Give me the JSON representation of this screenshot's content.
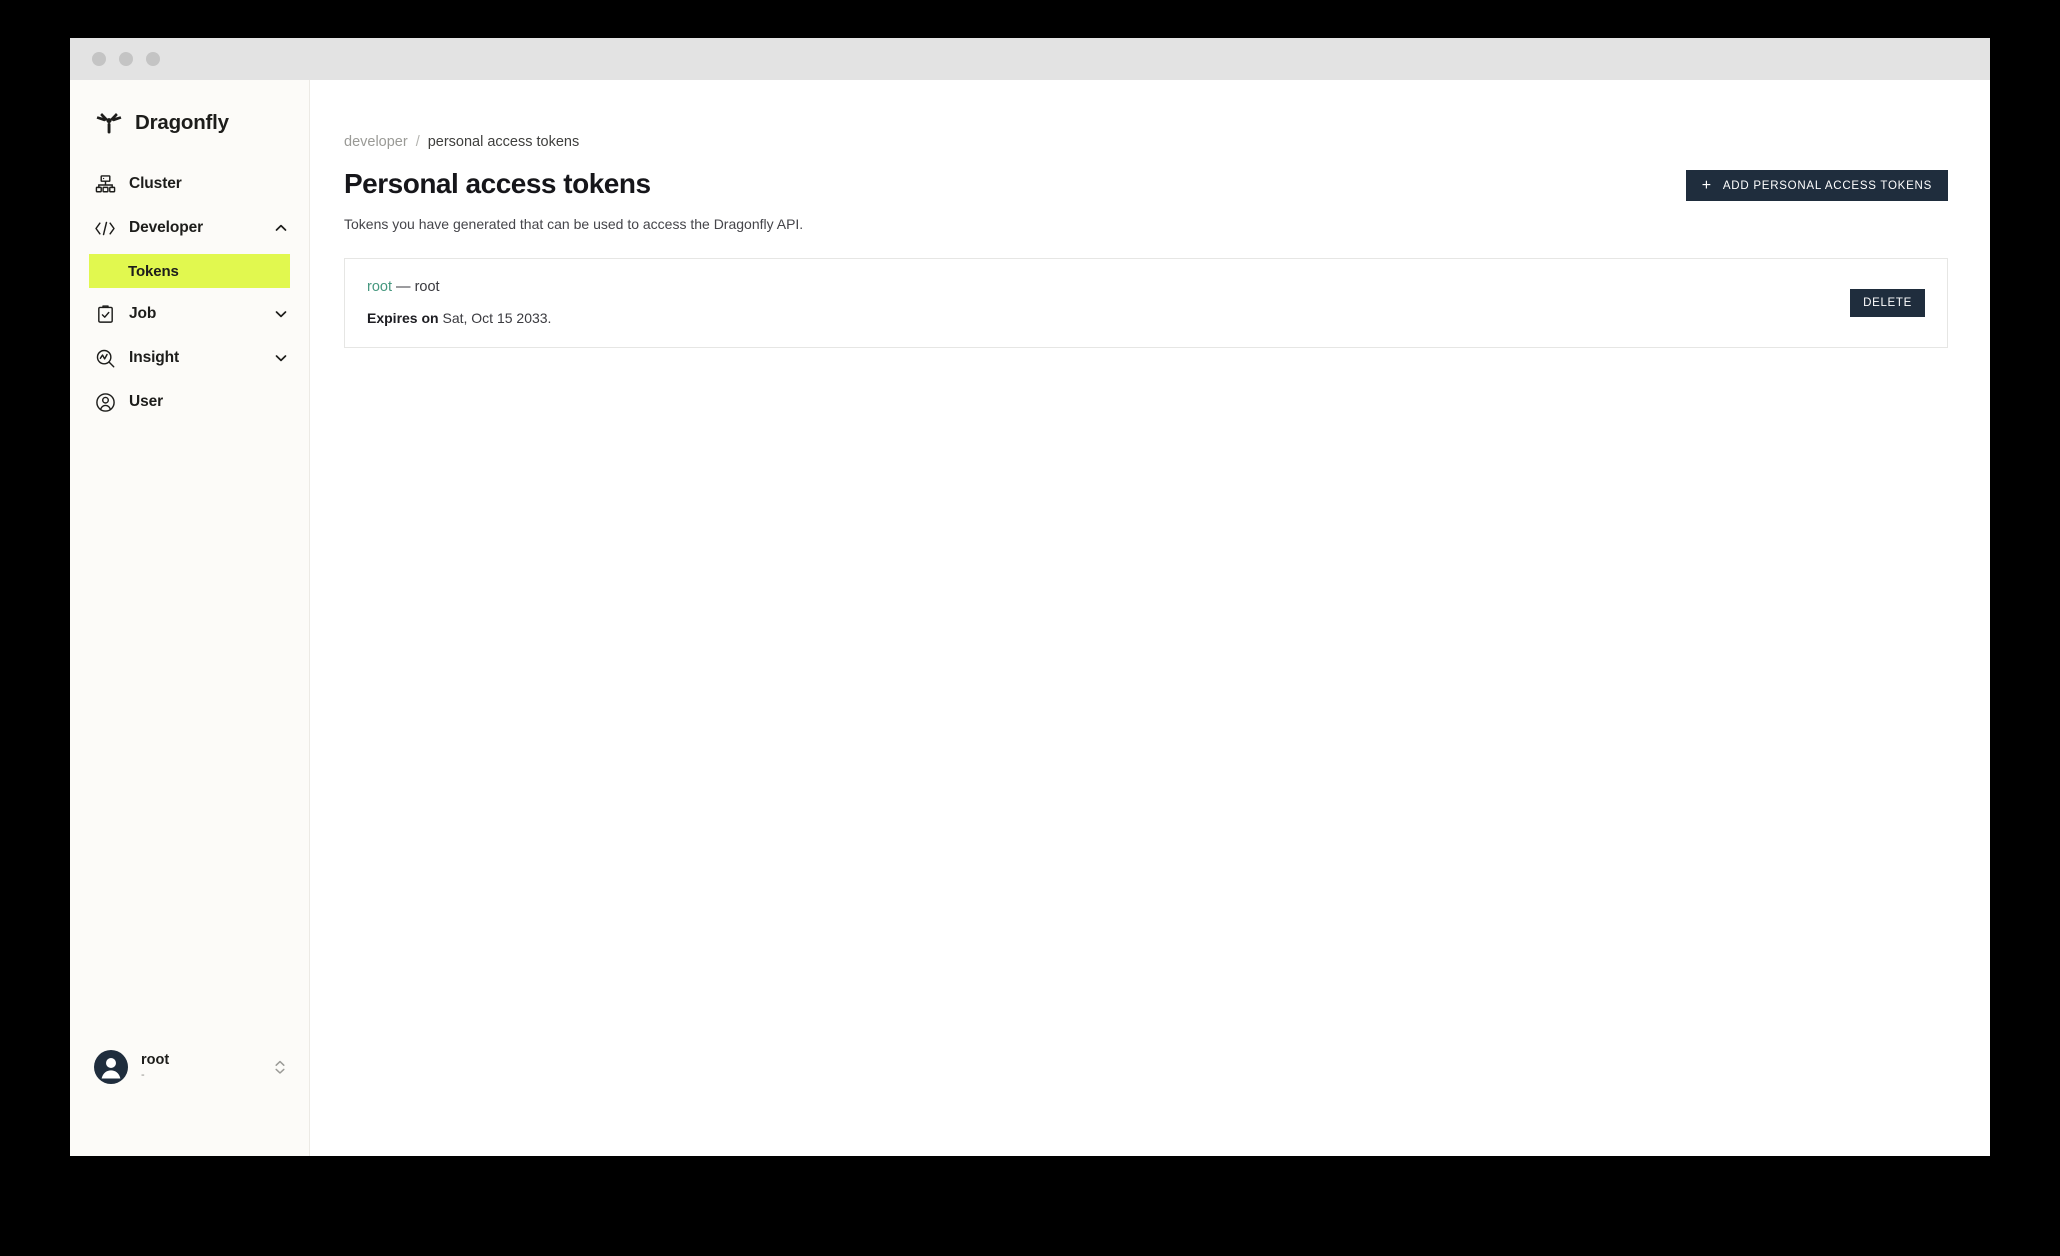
{
  "window": {
    "traffic_lights": [
      "close",
      "minimize",
      "maximize"
    ]
  },
  "sidebar": {
    "brand": {
      "name": "Dragonfly",
      "logo_icon": "dragonfly-logo-icon"
    },
    "items": [
      {
        "label": "Cluster",
        "icon": "cluster-icon",
        "expandable": false,
        "expanded": false
      },
      {
        "label": "Developer",
        "icon": "code-brackets-icon",
        "expandable": true,
        "expanded": true
      },
      {
        "label": "Job",
        "icon": "clipboard-check-icon",
        "expandable": true,
        "expanded": false
      },
      {
        "label": "Insight",
        "icon": "insight-magnifier-icon",
        "expandable": true,
        "expanded": false
      },
      {
        "label": "User",
        "icon": "user-circle-icon",
        "expandable": false,
        "expanded": false
      }
    ],
    "developer_children": [
      {
        "label": "Tokens",
        "active": true
      }
    ],
    "user": {
      "name": "root",
      "subtitle": "-",
      "avatar_icon": "avatar-person-icon",
      "selector_icon": "chevron-up-down-icon"
    }
  },
  "main": {
    "breadcrumb": {
      "parent": "developer",
      "separator": "/",
      "current": "personal access tokens"
    },
    "page_title": "Personal access tokens",
    "add_button": {
      "label": "ADD PERSONAL ACCESS TOKENS",
      "plus_icon": "plus-icon"
    },
    "subtitle": "Tokens you have generated that can be used to access the Dragonfly API.",
    "tokens": [
      {
        "name": "root",
        "separator": "—",
        "owner": "root",
        "expires_label": "Expires on",
        "expires_value": "Sat, Oct 15 2033.",
        "delete_label": "DELETE"
      }
    ]
  },
  "colors": {
    "accent_highlight": "#e1f84f",
    "button_dark": "#1f2d3d",
    "token_name": "#46987f",
    "sidebar_bg": "#fcfbf8",
    "titlebar_bg": "#e3e3e3"
  }
}
